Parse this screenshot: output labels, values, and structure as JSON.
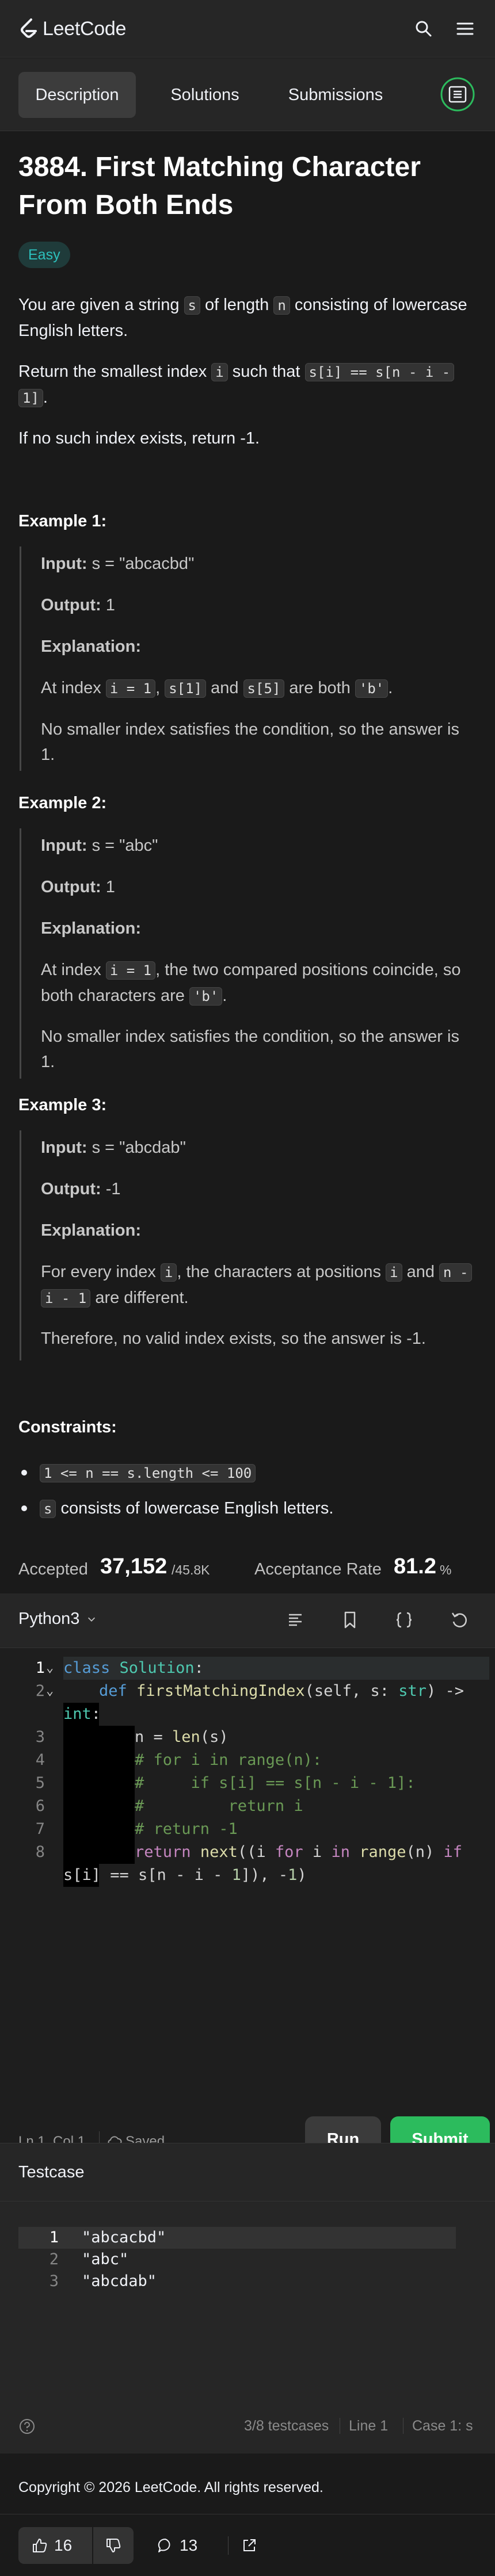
{
  "header": {
    "logo_text": "LeetCode"
  },
  "tabs": [
    {
      "label": "Description"
    },
    {
      "label": "Solutions"
    },
    {
      "label": "Submissions"
    }
  ],
  "problem": {
    "title": "3884. First Matching Character From Both Ends",
    "difficulty": "Easy",
    "p1_a": "You are given a string",
    "p1_s": "s",
    "p1_b": "of length",
    "p1_n": "n",
    "p1_c": "consisting of lowercase English letters.",
    "p2_a": "Return the smallest index",
    "p2_i": "i",
    "p2_b": "such that",
    "p2_code1": "s[i] == s[n - i -",
    "p2_code2": "1]",
    "p2_end": ".",
    "p3": "If no such index exists, return -1."
  },
  "examples": [
    {
      "title": "Example 1:",
      "input_label": "Input:",
      "input": "s = \"abcacbd\"",
      "output_label": "Output:",
      "output": "1",
      "explanation_label": "Explanation:",
      "e1_a": "At index",
      "e1_c1": "i = 1",
      "e1_b": ",",
      "e1_c2": "s[1]",
      "e1_d": "and",
      "e1_c3": "s[5]",
      "e1_e": "are both",
      "e1_c4": "'b'",
      "e1_f": ".",
      "e2": "No smaller index satisfies the condition, so the answer is 1."
    },
    {
      "title": "Example 2:",
      "input_label": "Input:",
      "input": "s = \"abc\"",
      "output_label": "Output:",
      "output": "1",
      "explanation_label": "Explanation:",
      "e1_a": "At index",
      "e1_c1": "i = 1",
      "e1_b": ", the two compared positions coincide, so both characters are",
      "e1_c2": "'b'",
      "e1_f": ".",
      "e2": "No smaller index satisfies the condition, so the answer is 1."
    },
    {
      "title": "Example 3:",
      "input_label": "Input:",
      "input": "s = \"abcdab\"",
      "output_label": "Output:",
      "output": "-1",
      "explanation_label": "Explanation:",
      "e1_a": "For every index",
      "e1_c1": "i",
      "e1_b": ", the characters at positions",
      "e1_c2": "i",
      "e1_d": "and",
      "e1_c3a": "n -",
      "e1_c3b": "i - 1",
      "e1_e": "are different.",
      "e2": "Therefore, no valid index exists, so the answer is -1."
    }
  ],
  "constraints": {
    "title": "Constraints:",
    "items": [
      {
        "code": "1 <= n == s.length <= 100",
        "text": ""
      },
      {
        "code": "s",
        "text": "consists of lowercase English letters."
      }
    ]
  },
  "stats": {
    "accepted_label": "Accepted",
    "accepted_value": "37,152",
    "accepted_total": "/45.8K",
    "rate_label": "Acceptance Rate",
    "rate_value": "81.2",
    "rate_unit": "%"
  },
  "editor": {
    "language": "Python3",
    "cursor": "Ln 1, Col 1",
    "saved": "Saved",
    "run_label": "Run",
    "submit_label": "Submit",
    "line_numbers": [
      "1",
      "2",
      "3",
      "4",
      "5",
      "6",
      "7",
      "8"
    ]
  },
  "testcase": {
    "title": "Testcase",
    "cases": [
      "\"abcacbd\"",
      "\"abc\"",
      "\"abcdab\""
    ],
    "line_numbers": [
      "1",
      "2",
      "3"
    ],
    "status_count": "3/8 testcases",
    "status_line": "Line 1",
    "status_case": "Case 1: s"
  },
  "footer": {
    "copyright": "Copyright © 2026 LeetCode. All rights reserved.",
    "likes": "16",
    "comments": "13"
  },
  "colors": {
    "accent_green": "#2cbb5d",
    "easy_teal": "#2dc1bd",
    "background": "#1a1a1a"
  }
}
